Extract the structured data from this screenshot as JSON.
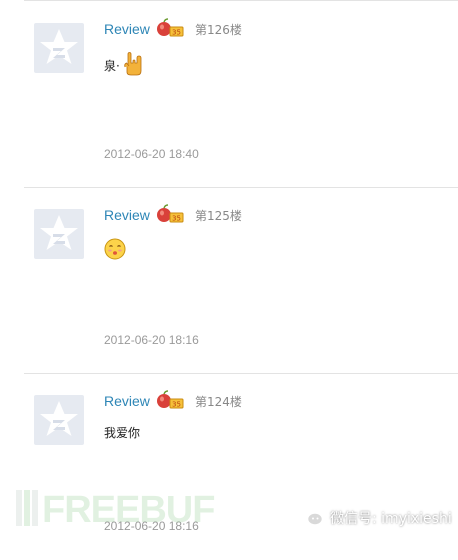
{
  "posts": [
    {
      "username": "Review",
      "floor": "第126楼",
      "content": "泉·",
      "emoji": "rock-hand-emoji",
      "timestamp": "2012-06-20 18:40"
    },
    {
      "username": "Review",
      "floor": "第125楼",
      "content": "",
      "emoji": "kiss-face-emoji",
      "timestamp": "2012-06-20 18:16"
    },
    {
      "username": "Review",
      "floor": "第124楼",
      "content": "我爱你",
      "emoji": "",
      "timestamp": "2012-06-20 18:16"
    }
  ],
  "watermark": {
    "logo_text": "FREEBUF",
    "wechat_label": "微信号: imyixieshi"
  },
  "colors": {
    "username": "#2e86b6",
    "timestamp": "#9a9a9a",
    "divider": "#e3e3e3",
    "avatar_bg": "#e6eaf1"
  }
}
